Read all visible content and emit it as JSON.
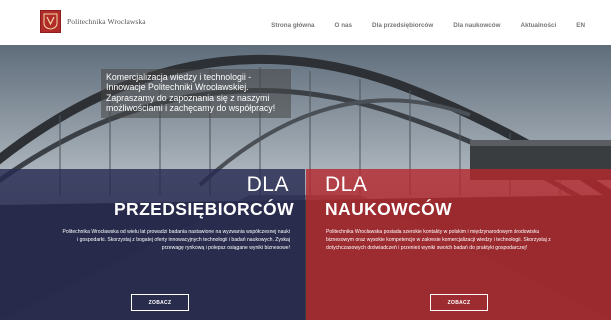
{
  "header": {
    "logo_text": "Politechnika Wrocławska",
    "nav": [
      {
        "label": "Strona główna"
      },
      {
        "label": "O nas"
      },
      {
        "label": "Dla przedsiębiorców"
      },
      {
        "label": "Dla naukowców"
      },
      {
        "label": "Aktualności"
      },
      {
        "label": "EN"
      }
    ]
  },
  "hero": {
    "intro_text": "Komercjalizacja wiedzy i technologii - Innowacje Politechniki Wrocławskiej. Zapraszamy do zapoznania się z naszymi możliwościami i zachęcamy do współpracy!"
  },
  "panels": {
    "left": {
      "small": "DLA",
      "big": "PRZEDSIĘBIORCÓW",
      "description": "Politechnika Wrocławska od wielu lat prowadzi badania nastawione na wyzwania współczesnej nauki i gospodarki. Skorzystaj z bogatej oferty innowacyjnych technologii i badań naukowych. Zyskaj przewagę rynkową i polepsz osiągane wyniki biznesowe!",
      "button": "ZOBACZ"
    },
    "right": {
      "small": "DLA",
      "big": "NAUKOWCÓW",
      "description": "Politechnika Wrocławska posiada szerokie kontakty w polskim i międzynarodowym środowisku biznesowym oraz wysokie kompetencje w zakresie komercjalizacji wiedzy i technologii. Skorzystaj z dotychczasowych doświadczeń i przenieś wyniki swoich badań do praktyki gospodarczej!",
      "button": "ZOBACZ"
    }
  },
  "colors": {
    "brand_red": "#b22b2b",
    "panel_navy": "#262850",
    "panel_red": "#b7282d"
  }
}
